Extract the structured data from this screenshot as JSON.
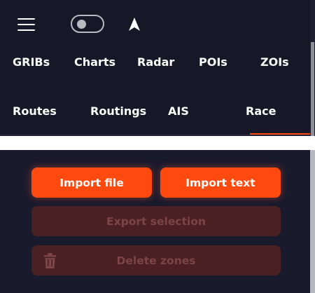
{
  "toolbar": {
    "menu_icon": "hamburger-menu-icon",
    "toggle_icon": "toggle-switch-icon",
    "nav_icon": "navigation-arrow-icon"
  },
  "tabs": {
    "row1": [
      "GRIBs",
      "Charts",
      "Radar",
      "POIs",
      "ZOIs"
    ],
    "row2": [
      "Routes",
      "Routings",
      "AIS",
      "Race"
    ],
    "active": "ZOIs"
  },
  "actions": {
    "import_file": "Import file",
    "import_text": "Import text",
    "export_selection": "Export selection",
    "delete_zones": "Delete zones",
    "delete_icon": "trash-icon"
  },
  "colors": {
    "accent": "#ff4a0f",
    "background": "#1a1a2d",
    "disabled_button": "#4a2022",
    "disabled_text": "#7d4448"
  }
}
